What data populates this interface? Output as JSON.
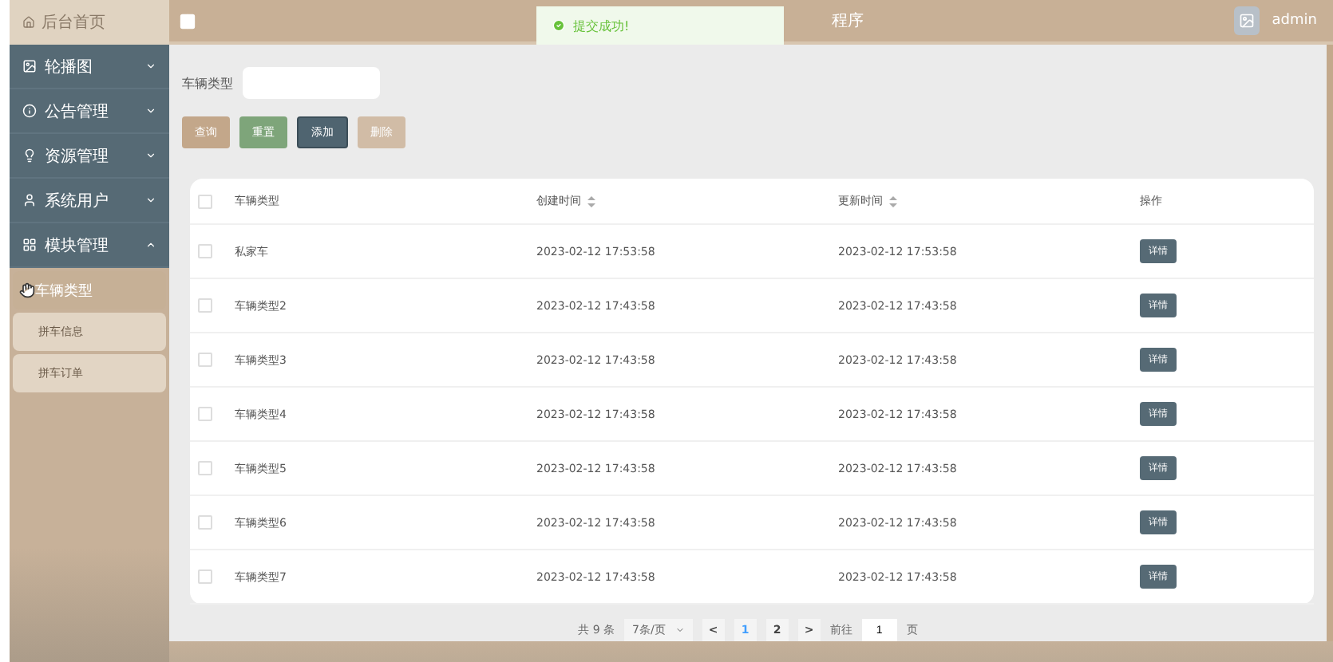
{
  "header": {
    "home": "后台首页",
    "title": "程序",
    "user": "admin"
  },
  "toast": {
    "text": "提交成功!"
  },
  "sidebar": {
    "items": [
      {
        "label": "轮播图",
        "expanded": false
      },
      {
        "label": "公告管理",
        "expanded": false
      },
      {
        "label": "资源管理",
        "expanded": false
      },
      {
        "label": "系统用户",
        "expanded": false
      },
      {
        "label": "模块管理",
        "expanded": true,
        "children": [
          {
            "label": "车辆类型",
            "selected": true
          },
          {
            "label": "拼车信息",
            "selected": false
          },
          {
            "label": "拼车订单",
            "selected": false
          }
        ]
      }
    ]
  },
  "search": {
    "label": "车辆类型"
  },
  "buttons": [
    {
      "label": "查询",
      "kind": "query"
    },
    {
      "label": "重置",
      "kind": "reset"
    },
    {
      "label": "添加",
      "kind": "add"
    },
    {
      "label": "删除",
      "kind": "delete",
      "disabled": true
    }
  ],
  "table": {
    "select_all_checked": false,
    "columns": [
      {
        "label": "车辆类型",
        "sortable": false
      },
      {
        "label": "创建时间",
        "sortable": true
      },
      {
        "label": "更新时间",
        "sortable": true
      },
      {
        "label": "操作",
        "sortable": false
      }
    ],
    "rows": [
      {
        "checked": false,
        "cells": [
          "私家车",
          "2023-02-12 17:53:58",
          "2023-02-12 17:53:58"
        ],
        "action": "详情"
      },
      {
        "checked": false,
        "cells": [
          "车辆类型2",
          "2023-02-12 17:43:58",
          "2023-02-12 17:43:58"
        ],
        "action": "详情"
      },
      {
        "checked": false,
        "cells": [
          "车辆类型3",
          "2023-02-12 17:43:58",
          "2023-02-12 17:43:58"
        ],
        "action": "详情"
      },
      {
        "checked": false,
        "cells": [
          "车辆类型4",
          "2023-02-12 17:43:58",
          "2023-02-12 17:43:58"
        ],
        "action": "详情"
      },
      {
        "checked": false,
        "cells": [
          "车辆类型5",
          "2023-02-12 17:43:58",
          "2023-02-12 17:43:58"
        ],
        "action": "详情"
      },
      {
        "checked": false,
        "cells": [
          "车辆类型6",
          "2023-02-12 17:43:58",
          "2023-02-12 17:43:58"
        ],
        "action": "详情"
      },
      {
        "checked": false,
        "cells": [
          "车辆类型7",
          "2023-02-12 17:43:58",
          "2023-02-12 17:43:58"
        ],
        "action": "详情"
      }
    ]
  },
  "pagination": {
    "total": "共 9 条",
    "page_size": "7条/页",
    "prev": "<",
    "pages": [
      {
        "label": "1",
        "selected": true
      },
      {
        "label": "2",
        "selected": false
      }
    ],
    "next": ">",
    "goto_label": "前往",
    "goto_value": "1",
    "goto_suffix": "页"
  }
}
